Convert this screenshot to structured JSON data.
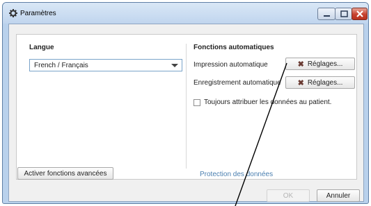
{
  "window": {
    "title": "Paramètres",
    "icon": "gear-icon",
    "controls": [
      "minimize-icon",
      "maximize-icon",
      "close-icon"
    ]
  },
  "language": {
    "heading": "Langue",
    "selected": "French / Français"
  },
  "auto_functions": {
    "heading": "Fonctions automatiques",
    "print_label": "Impression automatique",
    "save_label": "Enregistrement automatique",
    "settings_label": "Réglages...",
    "settings_icon": "x-icon",
    "always_assign_label": "Toujours attribuer les données au patient.",
    "always_assign_checked": false
  },
  "advanced_button": "Activer fonctions avancées",
  "data_protection_link": "Protection des données",
  "footer": {
    "ok_label": "OK",
    "cancel_label": "Annuler"
  },
  "colors": {
    "link": "#4a7fb0",
    "close_button": "#c7412f",
    "annotation_line": "#000000"
  }
}
